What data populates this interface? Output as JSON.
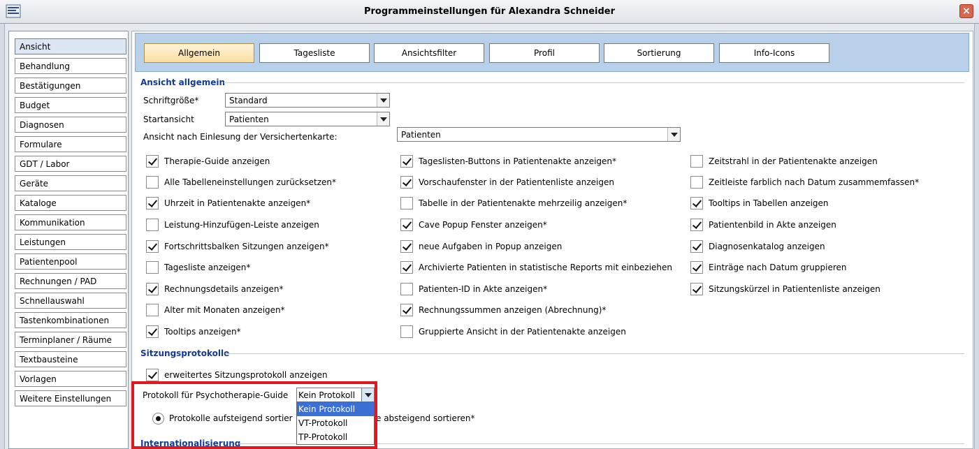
{
  "window": {
    "title": "Programmeinstellungen für Alexandra Schneider",
    "close": "×"
  },
  "sidebar": {
    "items": [
      "Ansicht",
      "Behandlung",
      "Bestätigungen",
      "Budget",
      "Diagnosen",
      "Formulare",
      "GDT / Labor",
      "Geräte",
      "Kataloge",
      "Kommunikation",
      "Leistungen",
      "Patientenpool",
      "Rechnungen / PAD",
      "Schnellauswahl",
      "Tastenkombinationen",
      "Terminplaner / Räume",
      "Textbausteine",
      "Vorlagen",
      "Weitere Einstellungen"
    ],
    "active": "Ansicht"
  },
  "tabs": [
    "Allgemein",
    "Tagesliste",
    "Ansichtsfilter",
    "Profil",
    "Sortierung",
    "Info-Icons"
  ],
  "ansicht": {
    "title": "Ansicht allgemein",
    "font_size_label": "Schriftgröße*",
    "font_size_value": "Standard",
    "start_label": "Startansicht",
    "start_value": "Patienten",
    "card_label": "Ansicht nach Einlesung der Versichertenkarte:",
    "card_value": "Patienten"
  },
  "checkboxes": {
    "col1": [
      {
        "label": "Therapie-Guide anzeigen",
        "checked": true
      },
      {
        "label": "Alle Tabelleneinstellungen zurücksetzen*",
        "checked": false
      },
      {
        "label": "Uhrzeit in Patientenakte anzeigen*",
        "checked": true
      },
      {
        "label": "Leistung-Hinzufügen-Leiste anzeigen",
        "checked": false
      },
      {
        "label": "Fortschrittsbalken Sitzungen anzeigen*",
        "checked": true
      },
      {
        "label": "Tagesliste anzeigen*",
        "checked": false
      },
      {
        "label": "Rechnungsdetails anzeigen*",
        "checked": true
      },
      {
        "label": "Alter mit Monaten anzeigen*",
        "checked": false
      },
      {
        "label": "Tooltips anzeigen*",
        "checked": true
      }
    ],
    "col2": [
      {
        "label": "Tageslisten-Buttons in Patientenakte anzeigen*",
        "checked": true
      },
      {
        "label": "Vorschaufenster in der Patientenliste anzeigen",
        "checked": true
      },
      {
        "label": "Tabelle in der Patientenakte mehrzeilig anzeigen*",
        "checked": false
      },
      {
        "label": "Cave Popup Fenster anzeigen*",
        "checked": true
      },
      {
        "label": "neue Aufgaben in Popup anzeigen",
        "checked": true
      },
      {
        "label": "Archivierte Patienten in statistische Reports mit einbeziehen",
        "checked": true
      },
      {
        "label": "Patienten-ID in Akte anzeigen*",
        "checked": false
      },
      {
        "label": "Rechnungssummen anzeigen (Abrechnung)*",
        "checked": true
      },
      {
        "label": "Gruppierte Ansicht in der Patientenakte anzeigen",
        "checked": false
      }
    ],
    "col3": [
      {
        "label": "Zeitstrahl in der Patientenakte anzeigen",
        "checked": false
      },
      {
        "label": "Zeitleiste farblich nach Datum zusammemfassen*",
        "checked": false
      },
      {
        "label": "Tooltips in Tabellen anzeigen",
        "checked": true
      },
      {
        "label": "Patientenbild in Akte anzeigen",
        "checked": true
      },
      {
        "label": "Diagnosenkatalog anzeigen",
        "checked": true
      },
      {
        "label": "Einträge nach Datum gruppieren",
        "checked": true
      },
      {
        "label": "Sitzungskürzel in Patientenliste anzeigen",
        "checked": true
      }
    ]
  },
  "sitzung": {
    "title": "Sitzungsprotokolle",
    "extended_label": "erweitertes Sitzungsprotokoll anzeigen",
    "extended_checked": true,
    "protocol_label": "Protokoll für Psychotherapie-Guide",
    "protocol_value": "Kein Protokoll",
    "options": [
      "Kein Protokoll",
      "VT-Protokoll",
      "TP-Protokoll"
    ],
    "radio_asc": "Protokolle aufsteigend sortier",
    "radio_desc": "e absteigend sortieren*"
  },
  "intl": {
    "title": "Internationalisierung"
  },
  "colors": {
    "accent": "#123a9a",
    "highlight": "#e0191f",
    "selection": "#3a6fd6"
  }
}
